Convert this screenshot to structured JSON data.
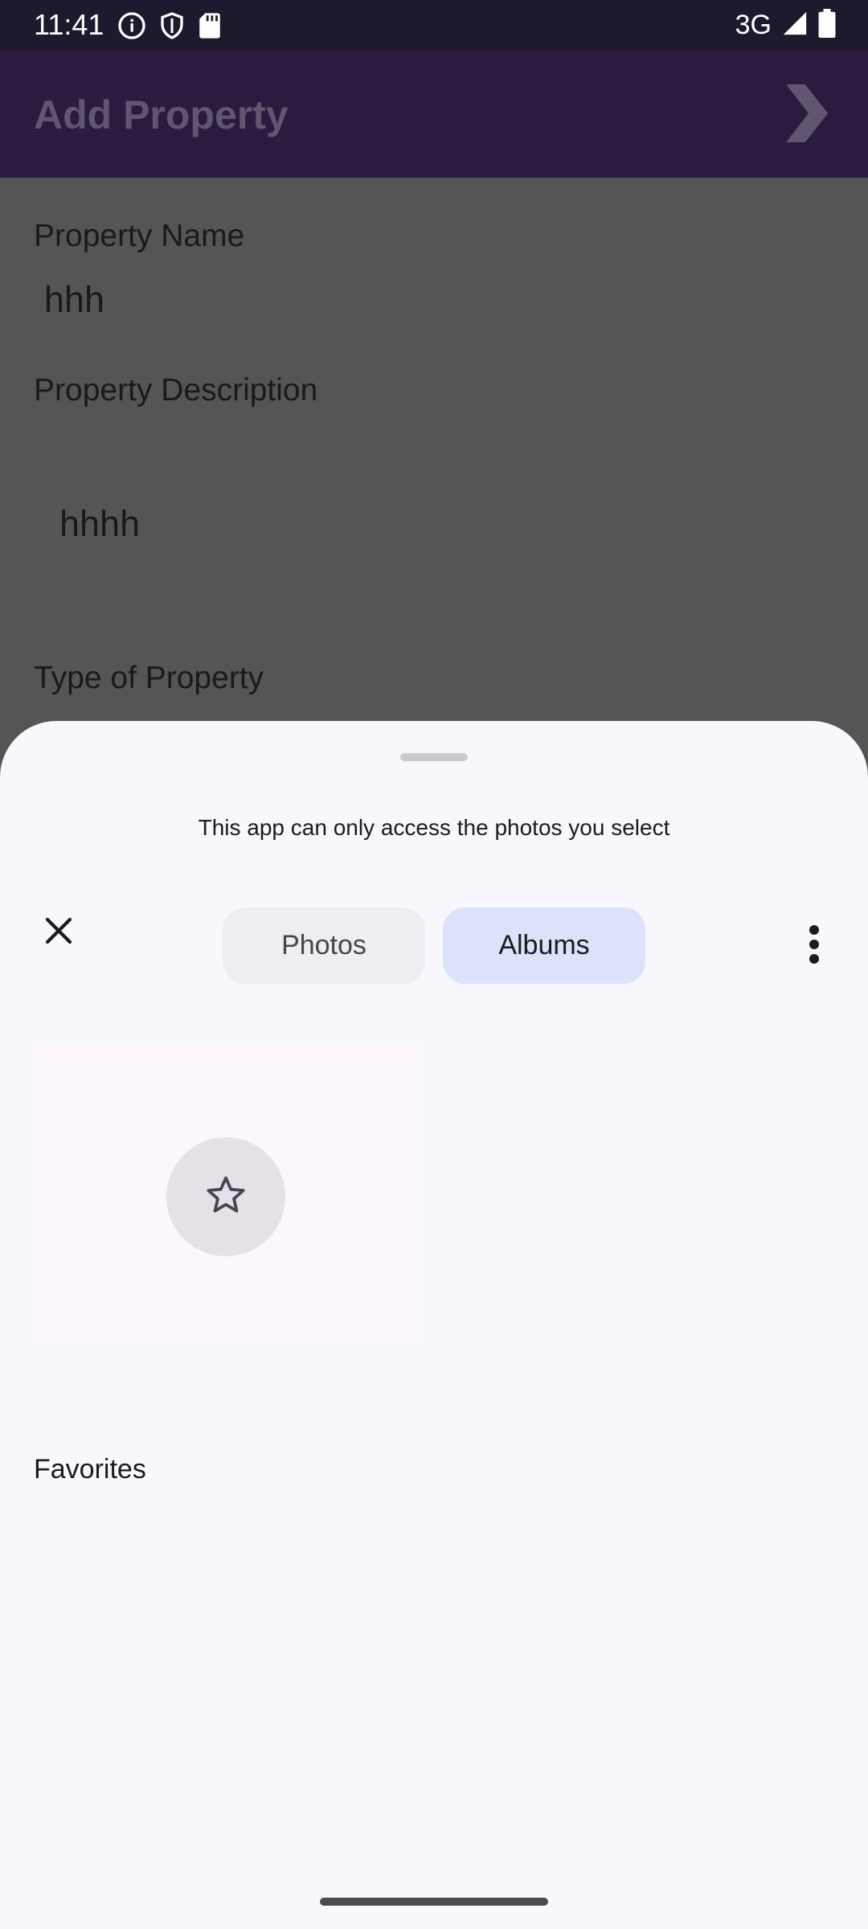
{
  "status_bar": {
    "time": "11:41",
    "network": "3G",
    "icons": [
      "info-icon",
      "shield-icon",
      "sd-card-icon",
      "signal-icon",
      "battery-icon"
    ]
  },
  "app_bar": {
    "title": "Add Property",
    "next_icon": "chevron-right-icon"
  },
  "form": {
    "name_label": "Property Name",
    "name_value": "hhh",
    "description_label": "Property Description",
    "description_value": "hhhh",
    "type_label": "Type of Property"
  },
  "photo_picker": {
    "notice": "This app can only access the photos you select",
    "tabs": [
      {
        "label": "Photos",
        "selected": false
      },
      {
        "label": "Albums",
        "selected": true
      }
    ],
    "albums": [
      {
        "label": "Favorites",
        "icon": "star-icon"
      }
    ]
  },
  "colors": {
    "scrim": "#555555",
    "app_bar": "#2b1b3f",
    "sheet_background": "#f7f7fd",
    "selected_tab": "#dbe2fa",
    "unselected_tab": "#ededf2"
  }
}
